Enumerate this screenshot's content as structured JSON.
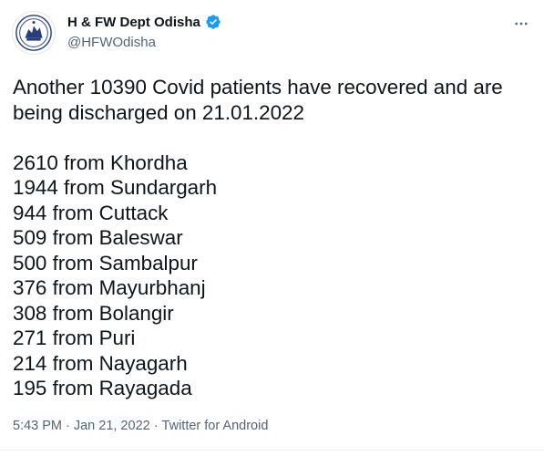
{
  "author": {
    "display_name": "H & FW Dept Odisha",
    "handle": "@HFWOdisha",
    "verified": true
  },
  "colors": {
    "verified_badge": "#1d9bf0",
    "text_primary": "#0f1419",
    "text_secondary": "#536471"
  },
  "tweet": {
    "intro_lines": [
      "Another 10390 Covid patients have recovered and are",
      "being discharged on 21.01.2022"
    ],
    "district_lines": [
      "2610 from Khordha",
      "1944 from Sundargarh",
      "944 from Cuttack",
      "509 from Baleswar",
      "500 from Sambalpur",
      "376 from Mayurbhanj",
      "308 from Bolangir",
      "271 from Puri",
      "214 from Nayagarh",
      "195 from Rayagada"
    ]
  },
  "meta": {
    "time": "5:43 PM",
    "separator": "·",
    "date": "Jan 21, 2022",
    "source": "Twitter for Android"
  },
  "icons": {
    "avatar": "odisha-emblem-icon",
    "verified": "verified-badge-icon",
    "more": "more-options-icon"
  }
}
